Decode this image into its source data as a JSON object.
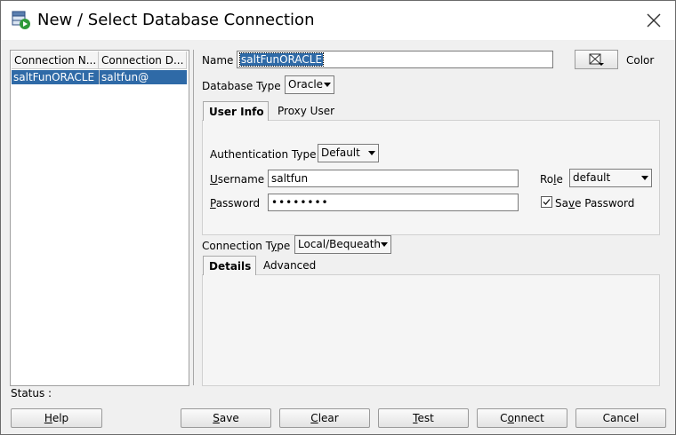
{
  "window": {
    "title": "New / Select Database Connection"
  },
  "connection_list": {
    "columns": [
      "Connection N...",
      "Connection D..."
    ],
    "rows": [
      {
        "name": "saltFunORACLE",
        "details": "saltfun@"
      }
    ]
  },
  "form": {
    "name_label": "Name",
    "name_value": "saltFunORACLE",
    "color_label": "Color",
    "database_type_label": "Database Type",
    "database_type_value": "Oracle",
    "tabs_top": [
      "User Info",
      "Proxy User"
    ],
    "auth_type_label": "Authentication Type",
    "auth_type_value": "Default",
    "username_label_u": "U",
    "username_label_rest": "sername",
    "username_value": "saltfun",
    "password_label_p": "P",
    "password_label_rest": "assword",
    "password_value": "••••••••",
    "role_label_a": "Ro",
    "role_label_u": "l",
    "role_label_b": "e",
    "role_value": "default",
    "save_password_a": "Sa",
    "save_password_u": "v",
    "save_password_b": "e Password",
    "save_password_checked": true,
    "connection_type_label_a": "Connection T",
    "connection_type_label_u": "y",
    "connection_type_label_b": "pe",
    "connection_type_value": "Local/Bequeath",
    "tabs_bottom": [
      "Details",
      "Advanced"
    ]
  },
  "status": {
    "label": "Status :"
  },
  "buttons": {
    "help_u": "H",
    "help_rest": "elp",
    "save_u": "S",
    "save_rest": "ave",
    "clear_u": "C",
    "clear_rest": "lear",
    "test_u": "T",
    "test_rest": "est",
    "connect_a": "C",
    "connect_u": "o",
    "connect_b": "nnect",
    "cancel": "Cancel"
  },
  "icons": {
    "app": "database-connection-icon",
    "close": "close-icon",
    "color": "color-picker-icon"
  },
  "colors": {
    "selection": "#2f6aa7",
    "window_bg": "#f0f0f0"
  }
}
